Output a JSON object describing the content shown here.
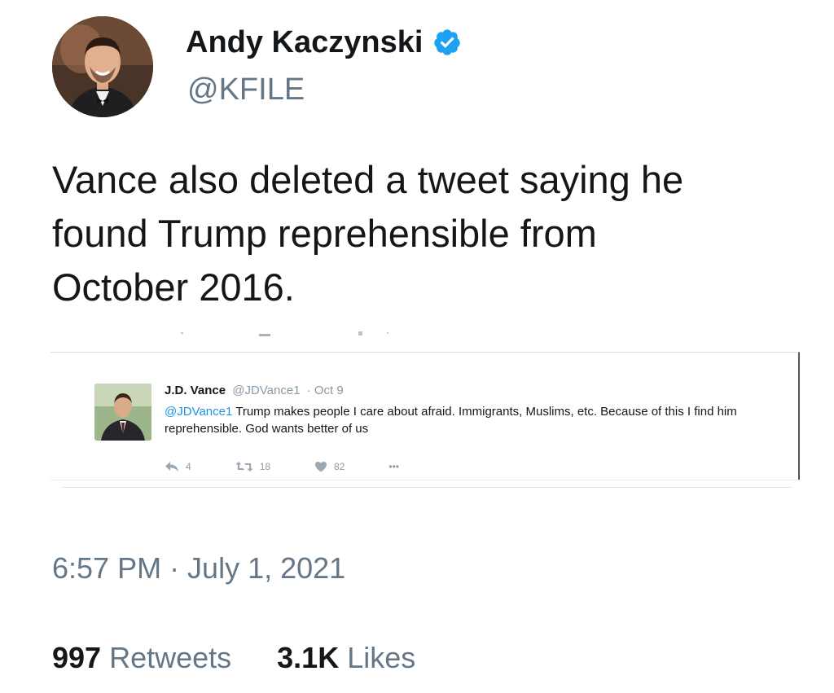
{
  "author": {
    "name": "Andy Kaczynski",
    "handle": "@KFILE",
    "verified": true
  },
  "tweet": {
    "text": "Vance also deleted a tweet saying he\nfound Trump reprehensible from\nOctober 2016."
  },
  "embedded_tweet": {
    "name": "J.D. Vance",
    "handle": "@JDVance1",
    "date": "· Oct 9",
    "mention": "@JDVance1",
    "text": " Trump makes people I care about afraid. Immigrants, Muslims, etc. Because of this I find him reprehensible. God wants better of us",
    "replies": "4",
    "retweets": "18",
    "likes": "82",
    "more": "•••"
  },
  "timestamp": "6:57 PM · July 1, 2021",
  "stats": {
    "retweets_count": "997",
    "retweets_label": "Retweets",
    "likes_count": "3.1K",
    "likes_label": "Likes"
  },
  "colors": {
    "verified_blue": "#1da1f2",
    "mention_blue": "#1b95e0",
    "secondary_gray": "#657786"
  },
  "icons": [
    "verified-badge-icon",
    "reply-icon",
    "retweet-icon",
    "heart-icon",
    "more-icon"
  ]
}
